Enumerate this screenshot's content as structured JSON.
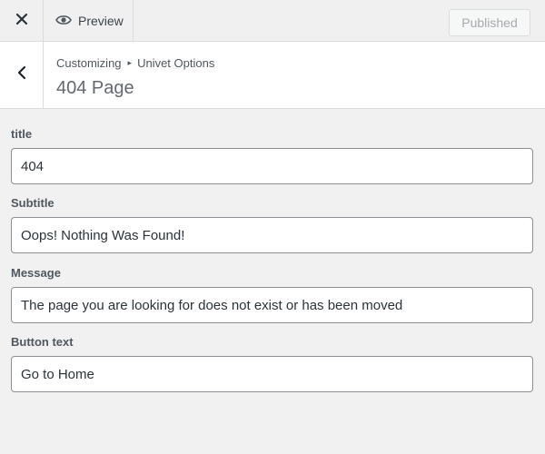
{
  "topbar": {
    "close_icon": "close-icon",
    "preview_icon": "eye-icon",
    "preview_label": "Preview",
    "publish_label": "Published"
  },
  "header": {
    "back_icon": "chevron-left-icon",
    "breadcrumb": {
      "root": "Customizing",
      "separator_icon": "triangle-right-icon",
      "section": "Univet Options"
    },
    "title": "404 Page"
  },
  "fields": [
    {
      "label": "title",
      "value": "404"
    },
    {
      "label": "Subtitle",
      "value": "Oops! Nothing Was Found!"
    },
    {
      "label": "Message",
      "value": "The page you are looking for does not exist or has been moved"
    },
    {
      "label": "Button text",
      "value": "Go to Home"
    }
  ],
  "colors": {
    "background": "#f1f1f1",
    "panel": "#ffffff",
    "border": "#dcdcde",
    "input_border": "#8c8f94",
    "disabled_text": "#a7aaad"
  }
}
